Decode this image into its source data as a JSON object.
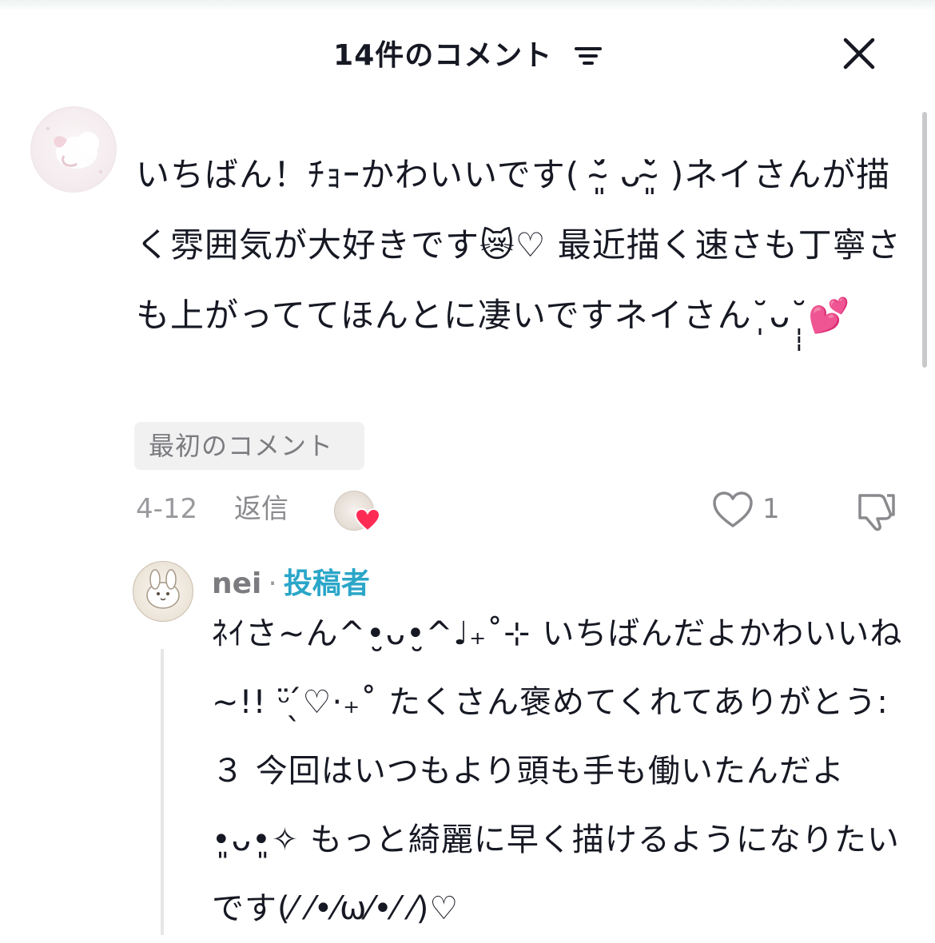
{
  "header": {
    "title": "14件のコメント"
  },
  "comment": {
    "text": "いちばん！ﾁｮｰかわいいです( ˘̴͈́ ᴗ˘̴͈̀ )ネイさんが描く雰囲気が大好きです😿♡ 最近描く速さも丁寧さも上がっててほんとに凄いですネイさん˘̩̩̩ᴗ˘̩̩̩💕",
    "badge": "最初のコメント",
    "date": "4-12",
    "reply_label": "返信",
    "like_count": "1"
  },
  "reply": {
    "author": "nei",
    "separator": "·",
    "creator_label": "投稿者",
    "text": "ﾈｲさ~ん^•̮ᴗ•̮^♩₊˚⊹ いちばんだよかわいいね~!! ᵕ̈ ̖́♡⋅₊˚ たくさん褒めてくれてありがとう:３ 今回はいつもより頭も手も働いたんだよ•͈ᴗ•͈✧ もっと綺麗に早く描けるようになりたいです(⁄ ⁄•⁄ω⁄•⁄ ⁄)♡"
  },
  "colors": {
    "accent_creator": "#2aa6c8",
    "like_heart": "#fe2c55",
    "text_primary": "#161823",
    "text_secondary": "#8a8a8e"
  },
  "icons": [
    "sort-icon",
    "close-icon",
    "heart-outline-icon",
    "dislike-icon",
    "liked-by-creator-heart-icon"
  ]
}
